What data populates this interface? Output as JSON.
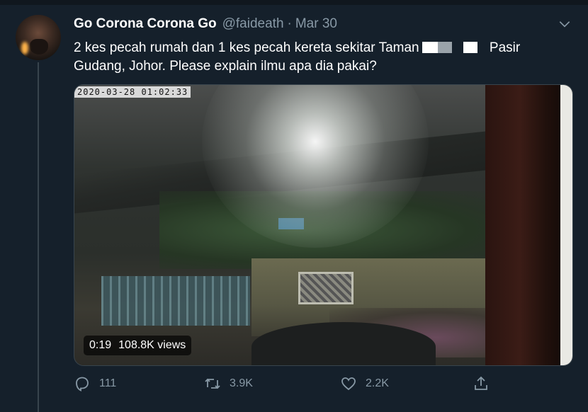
{
  "tweet": {
    "display_name": "Go Corona Corona Go",
    "handle": "@faideath",
    "separator": "·",
    "date": "Mar 30",
    "text_part1": "2 kes pecah rumah dan 1 kes pecah kereta sekitar Taman",
    "text_part2": "Pasir Gudang, Johor. Please explain ilmu apa dia pakai?"
  },
  "video": {
    "timestamp": "2020-03-28  01:02:33",
    "duration": "0:19",
    "views": "108.8K views"
  },
  "actions": {
    "replies": "111",
    "retweets": "3.9K",
    "likes": "2.2K"
  },
  "icons": {
    "reply": "reply-icon",
    "retweet": "retweet-icon",
    "like": "heart-icon",
    "share": "share-icon",
    "more": "chevron-down-icon"
  },
  "colors": {
    "background": "#15202b",
    "secondary_text": "#8899a6",
    "border": "#38444d"
  }
}
